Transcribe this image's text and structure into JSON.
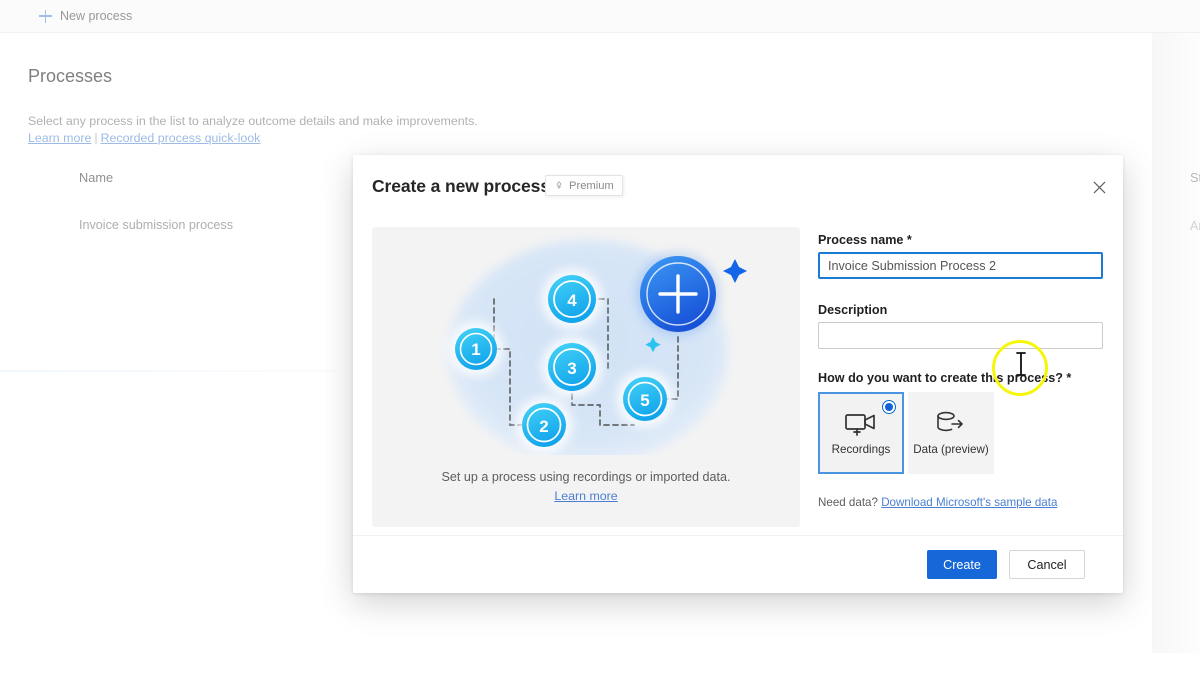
{
  "background": {
    "command_bar": {
      "new_process_label": "New process",
      "plus_icon": "plus-icon"
    },
    "page_title": "Processes",
    "subtitle": "Select any process in the list to analyze outcome details and make improvements.",
    "links": {
      "learn_more": "Learn more",
      "separator": "|",
      "quick_look": "Recorded process quick-look"
    },
    "table": {
      "columns": [
        "Name",
        "St",
        "An"
      ],
      "rows": [
        {
          "name": "Invoice submission process"
        }
      ]
    }
  },
  "dialog": {
    "title": "Create a new process",
    "premium_badge": {
      "label": "Premium",
      "icon": "diamond-icon"
    },
    "close_icon": "close-icon",
    "illustration": {
      "caption": "Set up a process using recordings or imported data.",
      "link": "Learn more",
      "nodes": [
        "1",
        "2",
        "3",
        "4",
        "5"
      ],
      "add_icon": "plus-circle-icon"
    },
    "form": {
      "process_name": {
        "label": "Process name",
        "required_marker": "*",
        "value": "Invoice Submission Process 2",
        "placeholder": ""
      },
      "description": {
        "label": "Description",
        "value": "",
        "placeholder": ""
      },
      "creation_method": {
        "label": "How do you want to create this process?",
        "required_marker": "*",
        "options": [
          {
            "label": "Recordings",
            "icon": "video-camera-add-icon",
            "selected": true
          },
          {
            "label": "Data (preview)",
            "icon": "database-export-icon",
            "selected": false
          }
        ]
      },
      "need_data": {
        "prefix": "Need data?",
        "link": "Download Microsoft's sample data"
      }
    },
    "footer": {
      "create_label": "Create",
      "cancel_label": "Cancel"
    }
  },
  "colors": {
    "accent_blue": "#1668d8",
    "link_blue": "#4a7fd1",
    "focus_blue": "#1a7bd4",
    "highlight_yellow": "#f6f60a",
    "card_gray": "#f3f3f3"
  }
}
